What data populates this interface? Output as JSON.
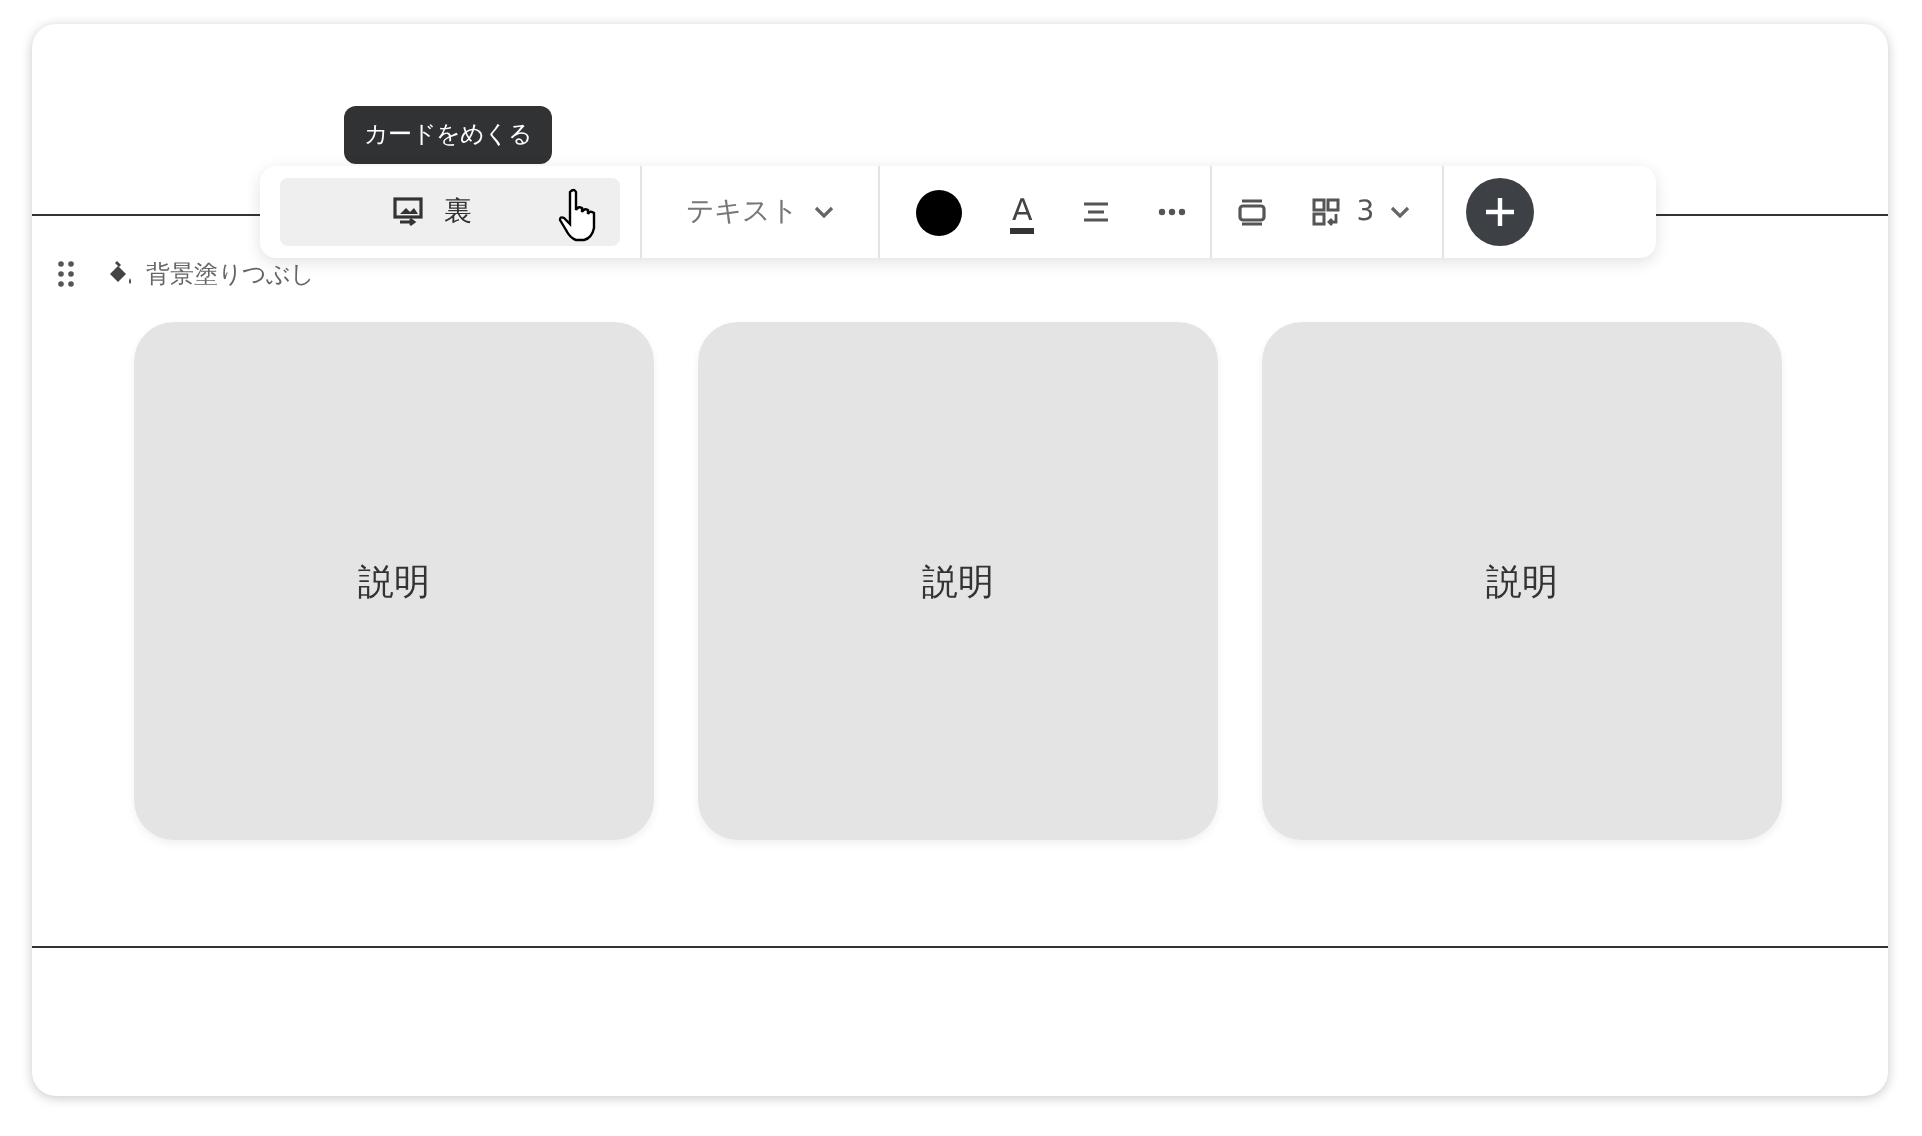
{
  "tooltip": "カードをめくる",
  "toolbar": {
    "flip_button": {
      "label": "裏",
      "selected": true
    },
    "text_style": "テキスト",
    "color": "#000000",
    "text_color_glyph": "A",
    "columns": "3"
  },
  "background_fill": "背景塗りつぶし",
  "cards": [
    {
      "text": "説明"
    },
    {
      "text": "説明"
    },
    {
      "text": "説明"
    }
  ]
}
